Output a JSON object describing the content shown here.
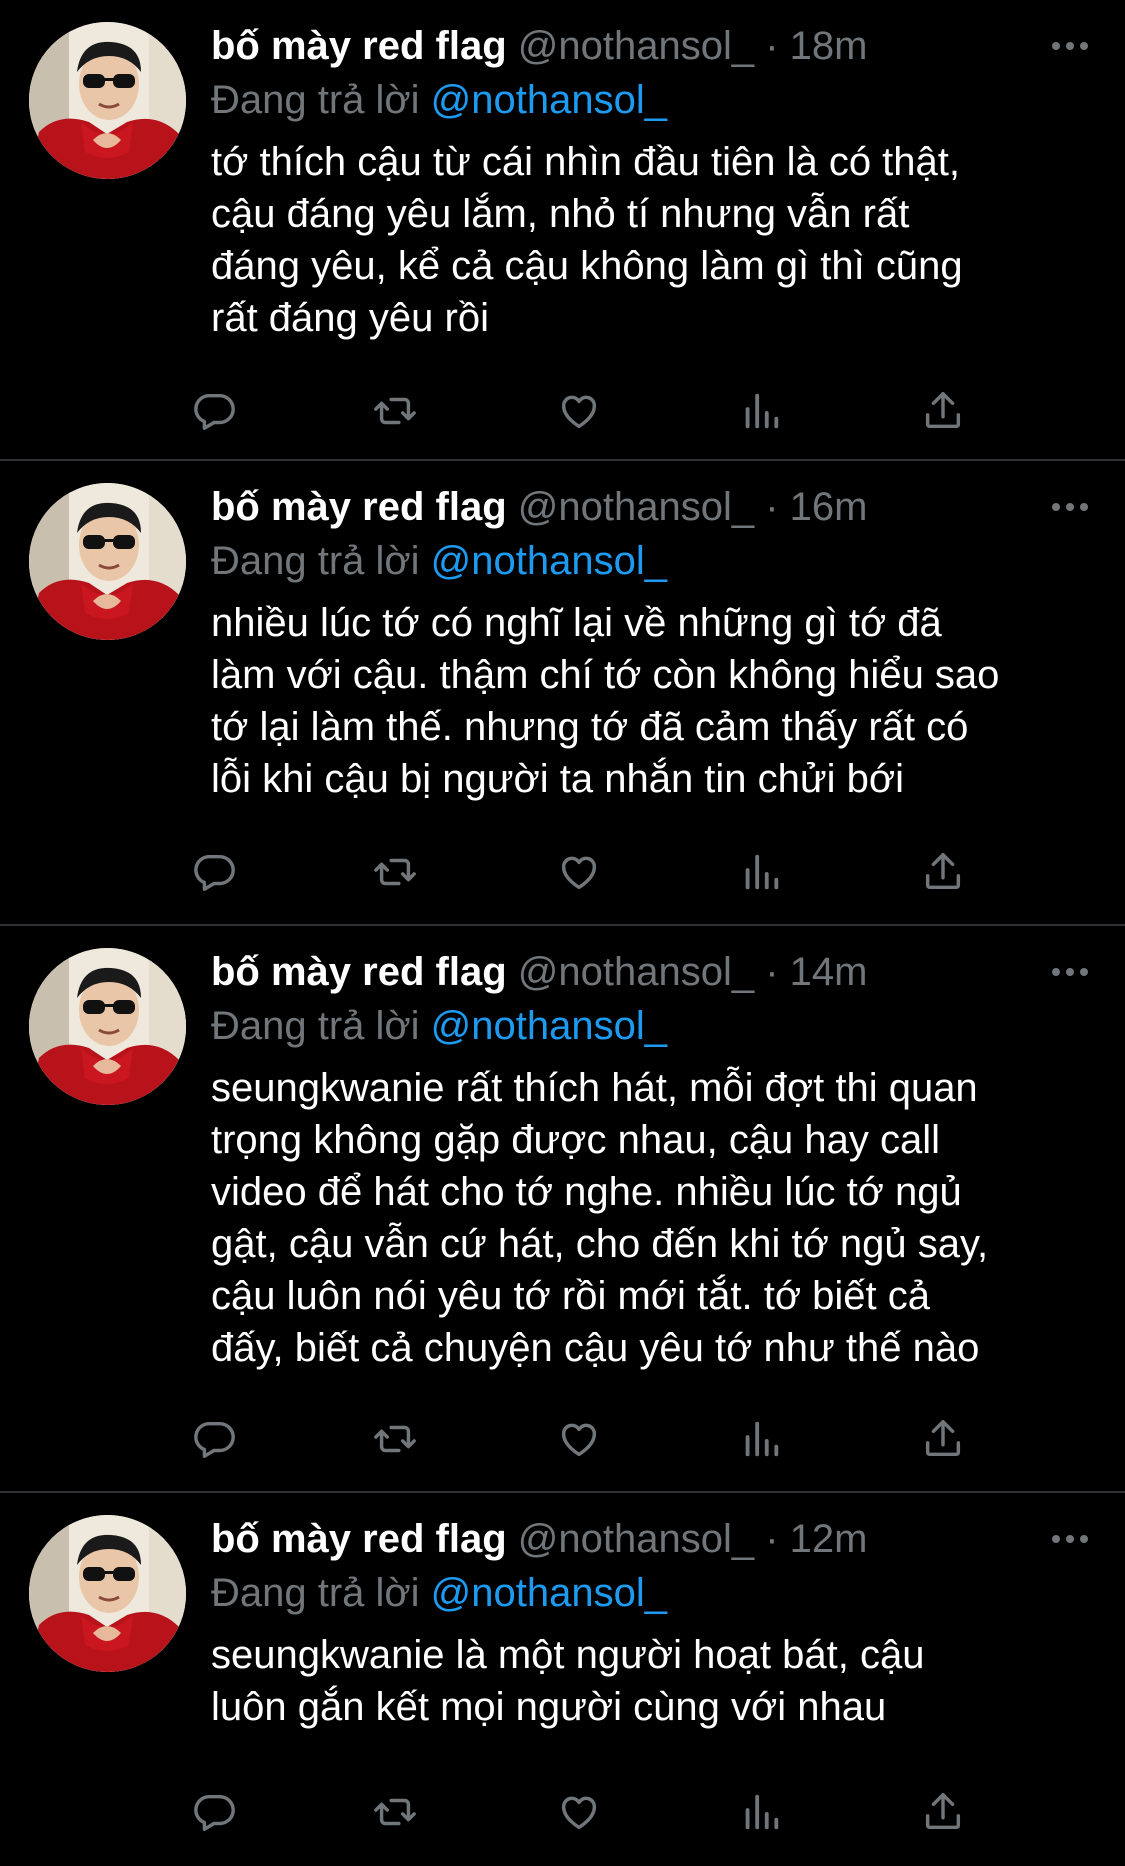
{
  "colors": {
    "background": "#000000",
    "text": "#ffffff",
    "muted": "#71767b",
    "link": "#1d9bf0",
    "divider": "#2f3336"
  },
  "icons": {
    "reply": "reply-icon",
    "retweet": "retweet-icon",
    "like": "like-icon",
    "views": "views-icon",
    "share": "share-icon",
    "more": "more-icon"
  },
  "tweets": [
    {
      "name": "bố mày red flag",
      "handle": "@nothansol_",
      "separator": "·",
      "time": "18m",
      "replying_label": "Đang trả lời",
      "replying_to": "@nothansol_",
      "lines": [
        "tớ thích cậu từ cái nhìn đầu tiên là có thật,",
        "cậu đáng yêu lắm, nhỏ tí nhưng vẫn rất",
        "đáng yêu, kể cả cậu không làm gì thì cũng",
        "rất đáng yêu rồi"
      ]
    },
    {
      "name": "bố mày red flag",
      "handle": "@nothansol_",
      "separator": "·",
      "time": "16m",
      "replying_label": "Đang trả lời",
      "replying_to": "@nothansol_",
      "lines": [
        "nhiều lúc tớ có nghĩ lại về những gì tớ đã",
        "làm với cậu. thậm chí tớ còn không hiểu sao",
        "tớ lại làm thế. nhưng tớ đã cảm thấy rất có",
        "lỗi khi cậu bị người ta nhắn tin chửi bới"
      ]
    },
    {
      "name": "bố mày red flag",
      "handle": "@nothansol_",
      "separator": "·",
      "time": "14m",
      "replying_label": "Đang trả lời",
      "replying_to": "@nothansol_",
      "lines": [
        "seungkwanie rất thích hát, mỗi đợt thi quan",
        "trọng không gặp được nhau, cậu hay call",
        "video để hát cho tớ nghe. nhiều lúc tớ ngủ",
        "gật, cậu vẫn cứ hát, cho đến khi tớ ngủ say,",
        "cậu luôn nói yêu tớ rồi mới tắt. tớ biết cả",
        "đấy, biết cả chuyện cậu yêu tớ như thế nào"
      ]
    },
    {
      "name": "bố mày red flag",
      "handle": "@nothansol_",
      "separator": "·",
      "time": "12m",
      "replying_label": "Đang trả lời",
      "replying_to": "@nothansol_",
      "lines": [
        "seungkwanie là một người hoạt bát, cậu",
        "luôn gắn kết mọi người cùng với nhau"
      ]
    }
  ]
}
